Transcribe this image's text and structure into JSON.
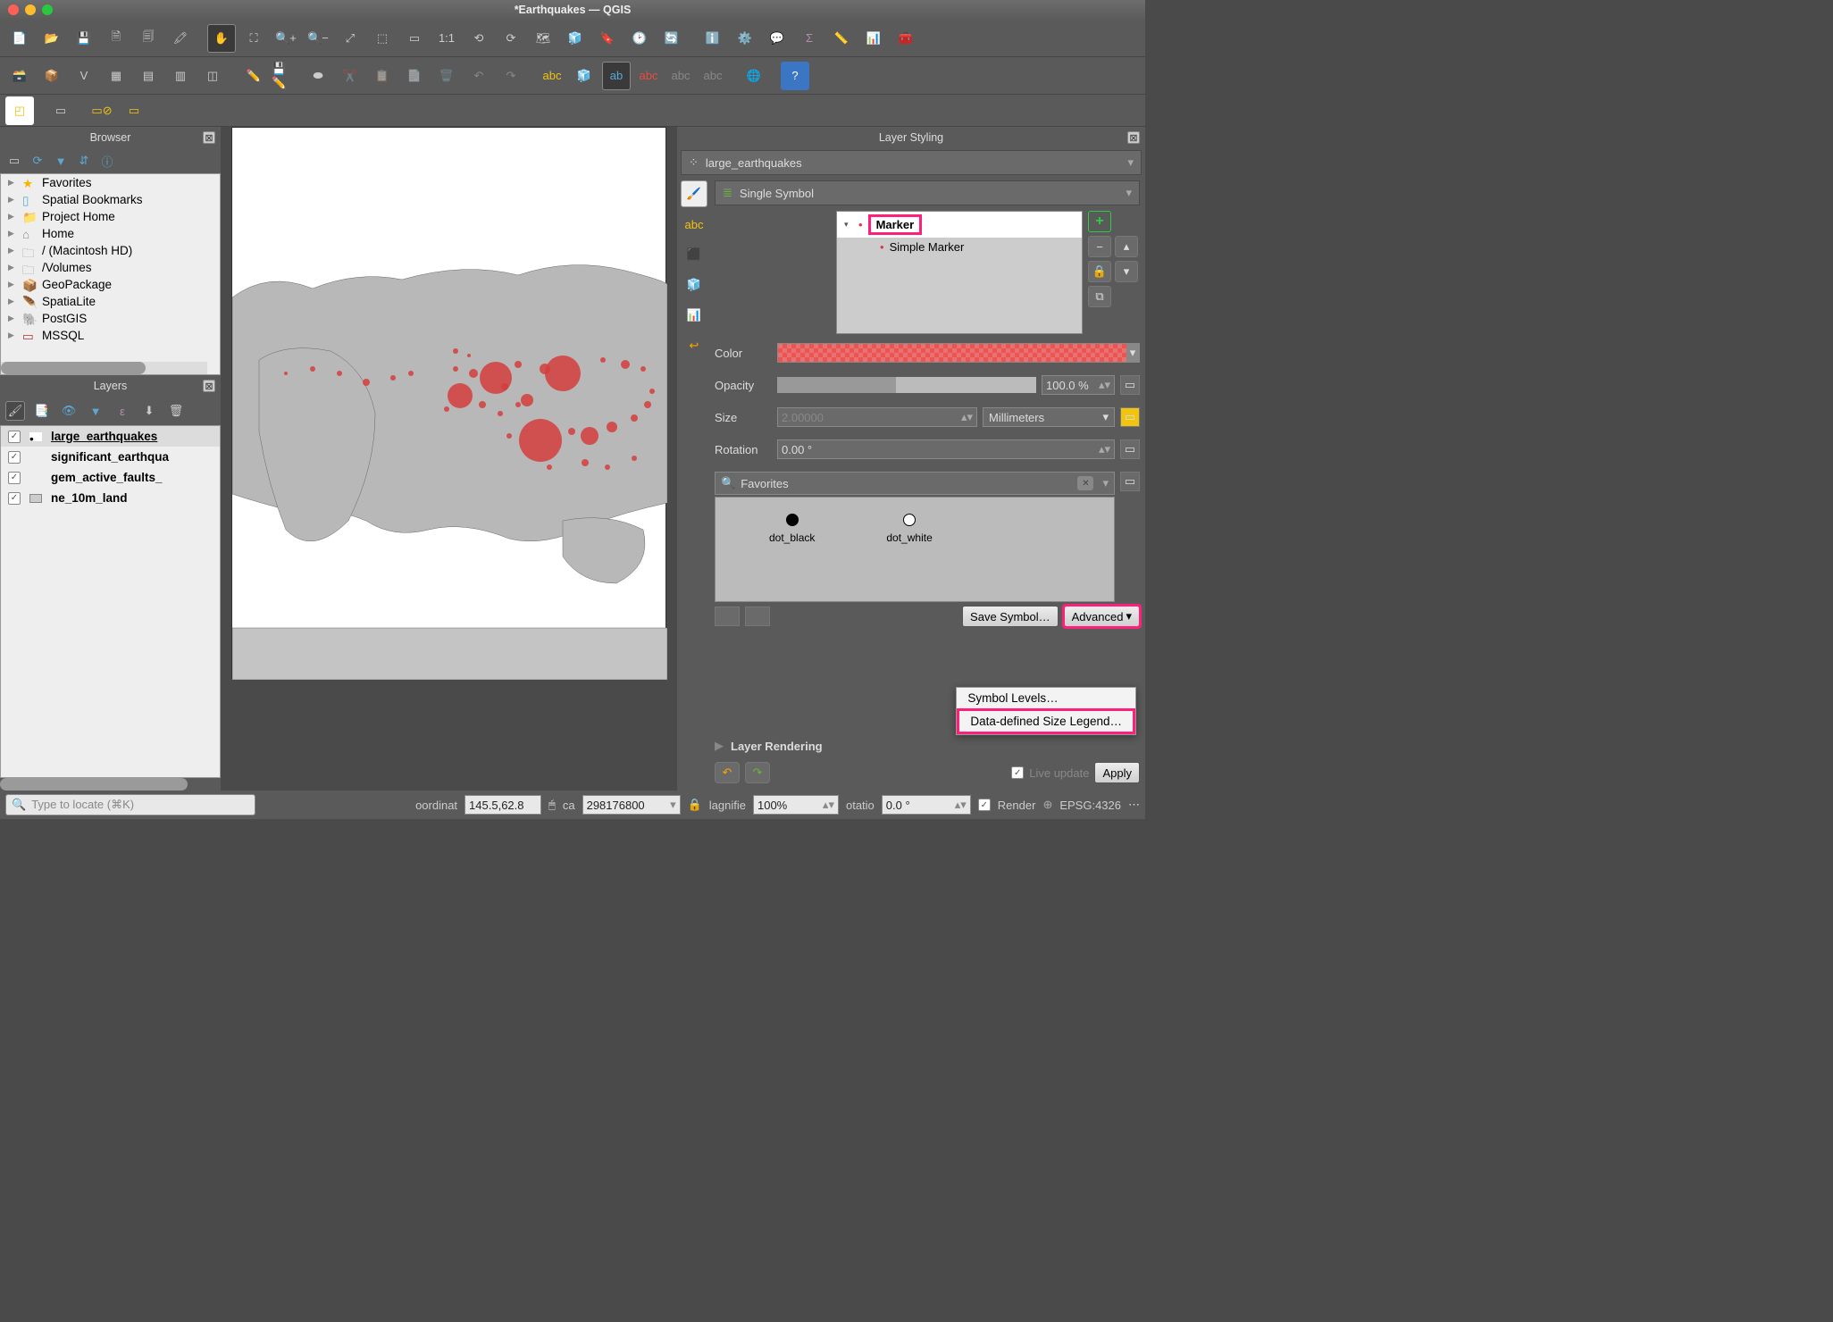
{
  "window": {
    "title": "*Earthquakes — QGIS"
  },
  "panels": {
    "browser": {
      "title": "Browser",
      "items": [
        {
          "name": "Favorites",
          "icon": "star"
        },
        {
          "name": "Spatial Bookmarks",
          "icon": "book"
        },
        {
          "name": "Project Home",
          "icon": "folder-home"
        },
        {
          "name": "Home",
          "icon": "home"
        },
        {
          "name": "/ (Macintosh HD)",
          "icon": "folder"
        },
        {
          "name": "/Volumes",
          "icon": "folder"
        },
        {
          "name": "GeoPackage",
          "icon": "db"
        },
        {
          "name": "SpatiaLite",
          "icon": "db"
        },
        {
          "name": "PostGIS",
          "icon": "pg"
        },
        {
          "name": "MSSQL",
          "icon": "ms"
        }
      ]
    },
    "layers": {
      "title": "Layers",
      "items": [
        {
          "name": "large_earthquakes",
          "checked": true,
          "selected": true,
          "underline": true
        },
        {
          "name": "significant_earthqua",
          "checked": true
        },
        {
          "name": "gem_active_faults_",
          "checked": true,
          "grey": true
        },
        {
          "name": "ne_10m_land",
          "checked": true,
          "grey": true
        }
      ]
    },
    "styling": {
      "title": "Layer Styling",
      "layer": "large_earthquakes",
      "renderer": "Single Symbol",
      "tree": {
        "root": "Marker",
        "child": "Simple Marker"
      },
      "color_label": "Color",
      "opacity_label": "Opacity",
      "opacity_value": "100.0 %",
      "size_label": "Size",
      "size_value": "2.00000",
      "size_unit": "Millimeters",
      "rotation_label": "Rotation",
      "rotation_value": "0.00 °",
      "fav_label": "Favorites",
      "swatches": [
        {
          "name": "dot_black"
        },
        {
          "name": "dot_white"
        }
      ],
      "save_symbol": "Save Symbol…",
      "advanced": "Advanced",
      "menu": {
        "levels": "Symbol Levels…",
        "dd_legend": "Data-defined Size Legend…"
      },
      "layer_rendering": "Layer Rendering",
      "live_update": "Live update",
      "apply": "Apply"
    }
  },
  "status": {
    "locator_placeholder": "Type to locate (⌘K)",
    "coord_label": "oordinat",
    "coord_value": "145.5,62.8",
    "scale_label": "ca",
    "scale_value": "298176800",
    "magnifier_label": "lagnifie",
    "magnifier_value": "100%",
    "rotation_label": "otatio",
    "rotation_value": "0.0 °",
    "render_label": "Render",
    "crs": "EPSG:4326"
  }
}
